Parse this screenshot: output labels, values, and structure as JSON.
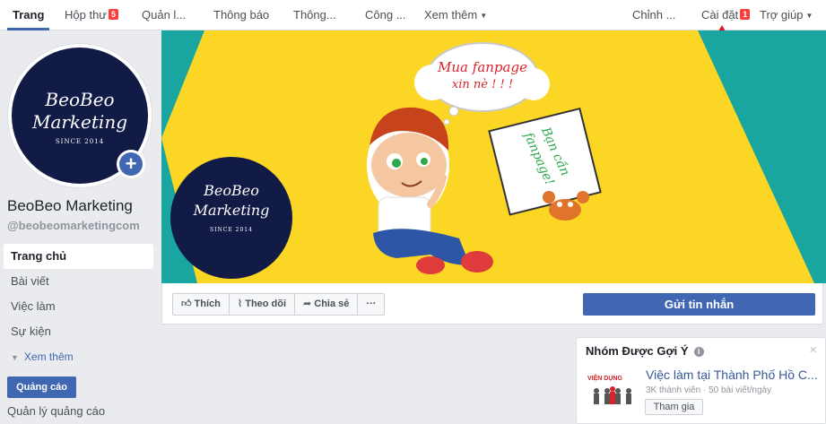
{
  "tabs": [
    {
      "label": "Trang",
      "active": true
    },
    {
      "label": "Hộp thư",
      "badge": "5"
    },
    {
      "label": "Quản l..."
    },
    {
      "label": "Thông báo"
    },
    {
      "label": "Thông..."
    },
    {
      "label": "Công ..."
    },
    {
      "label": "Xem thêm"
    },
    {
      "label": "Chỉnh ..."
    },
    {
      "label": "Cài đặt",
      "badge": "1"
    },
    {
      "label": "Trợ giúp"
    }
  ],
  "page": {
    "name": "BeoBeo Marketing",
    "handle": "@beobeomarketingcom",
    "logo_line1": "BeoBeo",
    "logo_line2": "Marketing",
    "logo_since": "SINCE 2014"
  },
  "nav": {
    "items": [
      "Trang chủ",
      "Bài viết",
      "Việc làm",
      "Sự kiện"
    ],
    "more": "Xem thêm",
    "promote": "Quảng cáo",
    "ad_manager": "Quản lý quảng cáo"
  },
  "cover": {
    "bubble_line1": "Mua fanpage",
    "bubble_line2": "xin nè ! ! !",
    "sign_line1": "Bạn cần",
    "sign_line2": "fanpage!"
  },
  "actions": {
    "like": "Thích",
    "follow": "Theo dõi",
    "share": "Chia sẻ",
    "more": "···",
    "send_message": "Gửi tin nhắn"
  },
  "groups": {
    "title": "Nhóm Được Gợi Ý",
    "close": "×",
    "item_name": "Việc làm tại Thành Phố Hồ C...",
    "item_meta": "3K thành viên · 50 bài viết/ngày",
    "join": "Tham gia",
    "thumb_text": "VIỆN DỤNG"
  },
  "colors": {
    "accent": "#4267b2",
    "cover_yellow": "#fbd625",
    "cover_teal": "#1aa6a0",
    "logo_navy": "#121a46",
    "annotation_red": "#e8141c"
  },
  "icons": [
    "plus-icon",
    "thumbs-up-icon",
    "rss-icon",
    "share-arrow-icon",
    "info-icon",
    "close-icon",
    "caret-down-icon"
  ]
}
